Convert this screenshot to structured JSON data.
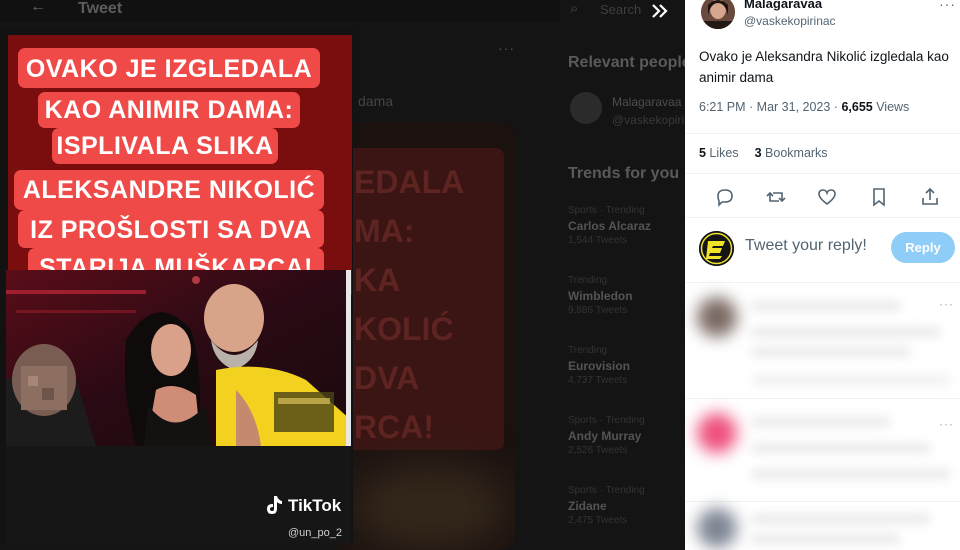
{
  "background_page": {
    "header_title": "Tweet",
    "snippet_text": "dama",
    "media_overlay_text": "EDALA\nMA:\nKA\nKOLIĆ\nDVA\nRCA!",
    "search_placeholder": "Search",
    "relevant_title": "Relevant people",
    "relevant_person": {
      "name": "Malagaravaa",
      "handle": "@vaskekopirinac"
    },
    "trends_title": "Trends for you",
    "trends": [
      {
        "category": "Sports · Trending",
        "name": "Carlos Alcaraz",
        "count": "1,544 Tweets"
      },
      {
        "category": "Trending",
        "name": "Wimbledon",
        "count": "9,886 Tweets"
      },
      {
        "category": "Trending",
        "name": "Eurovision",
        "count": "4,737 Tweets"
      },
      {
        "category": "Sports · Trending",
        "name": "Andy Murray",
        "count": "2,526 Tweets"
      },
      {
        "category": "Sports · Trending",
        "name": "Zidane",
        "count": "2,475 Tweets"
      }
    ]
  },
  "media": {
    "caption_lines": [
      "OVAKO JE IZGLEDALA",
      "KAO ANIMIR DAMA:",
      "ISPLIVALA SLIKA",
      "ALEKSANDRE NIKOLIĆ",
      "IZ PROŠLOSTI SA DVA",
      "STARIJA MUŠKARCA!"
    ],
    "watermark_brand": "TikTok",
    "watermark_handle": "@un_po_2"
  },
  "tweet": {
    "display_name": "Malagaravaa",
    "handle": "@vaskekopirinac",
    "text": "Ovako je Aleksandra Nikolić izgledala kao animir dama",
    "time": "6:21 PM · Mar 31, 2023 · ",
    "views_count": "6,655",
    "views_label": " Views",
    "likes_count": "5",
    "likes_label": " Likes",
    "bookmarks_count": "3",
    "bookmarks_label": " Bookmarks"
  },
  "reply": {
    "placeholder": "Tweet your reply!",
    "button_label": "Reply"
  },
  "colors": {
    "accent": "#1d9bf0",
    "reply_button": "#8ecdf7",
    "caption_red": "#ef4a47"
  }
}
